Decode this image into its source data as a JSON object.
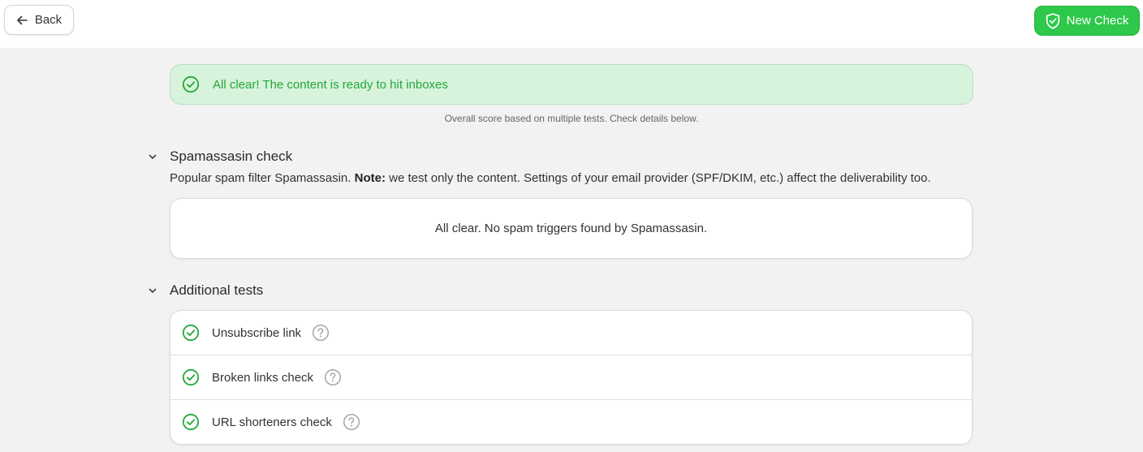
{
  "header": {
    "back_label": "Back",
    "new_check_label": "New Check",
    "accent_color": "#2ec84b"
  },
  "result": {
    "banner_text": "All clear! The content is ready to hit inboxes",
    "score_note": "Overall score based on multiple tests. Check details below.",
    "status_color": "#22a83a"
  },
  "spamassassin": {
    "title": "Spamassasin check",
    "description_prefix": "Popular spam filter Spamassasin.",
    "description_note_label": "Note:",
    "description_suffix": "we test only the content. Settings of your email provider (SPF/DKIM, etc.) affect the deliverability too.",
    "result_text": "All clear. No spam triggers found by Spamassasin.",
    "expanded": true
  },
  "additional_tests": {
    "title": "Additional tests",
    "expanded": true,
    "items": [
      {
        "label": "Unsubscribe link",
        "status": "passed",
        "icon": "check-circle-icon"
      },
      {
        "label": "Broken links check",
        "status": "passed",
        "icon": "check-circle-icon"
      },
      {
        "label": "URL shorteners check",
        "status": "passed",
        "icon": "check-circle-icon"
      }
    ]
  }
}
